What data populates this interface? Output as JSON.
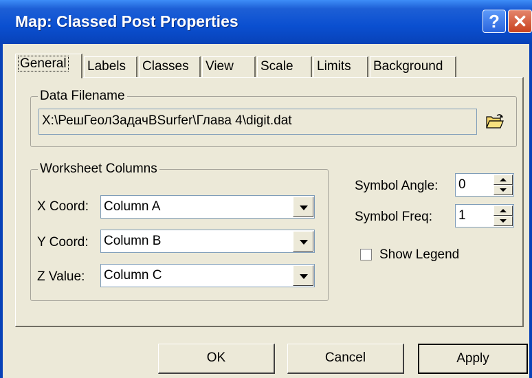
{
  "window": {
    "title": "Map: Classed Post Properties",
    "help_label": "?",
    "close_label": "✕"
  },
  "tabs": [
    {
      "label": "General"
    },
    {
      "label": "Labels"
    },
    {
      "label": "Classes"
    },
    {
      "label": "View"
    },
    {
      "label": "Scale"
    },
    {
      "label": "Limits"
    },
    {
      "label": "Background"
    }
  ],
  "data_file": {
    "group_title": "Data Filename",
    "path": "X:\\РешГеолЗадачВSurfer\\Глава 4\\digit.dat",
    "icon": "open-folder-icon"
  },
  "worksheet": {
    "group_title": "Worksheet Columns",
    "x_label": "X Coord:",
    "x_value": "Column A",
    "y_label": "Y Coord:",
    "y_value": "Column B",
    "z_label": "Z Value:",
    "z_value": "Column C"
  },
  "symbol": {
    "angle_label": "Symbol Angle:",
    "angle_value": "0",
    "freq_label": "Symbol Freq:",
    "freq_value": "1"
  },
  "legend": {
    "label": "Show Legend",
    "checked": false
  },
  "buttons": {
    "ok": "OK",
    "cancel": "Cancel",
    "apply": "Apply"
  },
  "colors": {
    "titlebar": "#0a4fd0",
    "dialog_bg": "#ece9d8",
    "close_button": "#c9431f"
  }
}
